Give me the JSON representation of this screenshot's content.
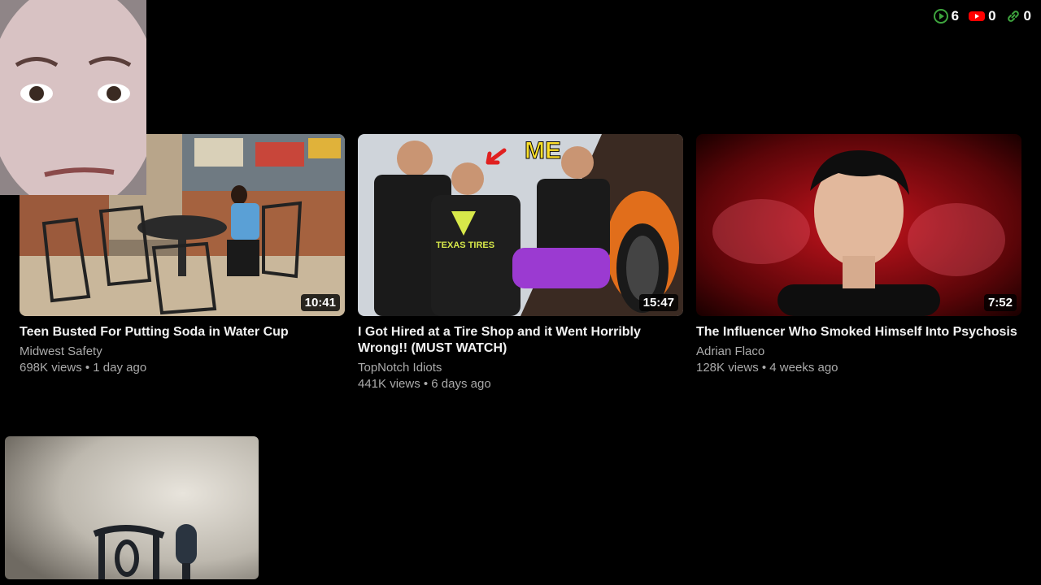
{
  "counters": [
    {
      "icon": "play-icon",
      "value": "6",
      "color": "#3ea53e"
    },
    {
      "icon": "youtube-icon",
      "value": "0",
      "color": "#ff0000"
    },
    {
      "icon": "link-icon",
      "value": "0",
      "color": "#3ea53e"
    }
  ],
  "videos": [
    {
      "title": "Teen Busted For Putting Soda in Water Cup",
      "channel": "Midwest Safety",
      "meta": "698K views • 1 day ago",
      "duration": "10:41"
    },
    {
      "title": "I Got Hired at a Tire Shop and it Went Horribly Wrong!! (MUST WATCH)",
      "channel": "TopNotch Idiots",
      "meta": "441K views • 6 days ago",
      "duration": "15:47",
      "overlay_text": "ME",
      "shirt_text": "TEXAS TIRES"
    },
    {
      "title": "The Influencer Who Smoked Himself Into Psychosis",
      "channel": "Adrian Flaco",
      "meta": "128K views • 4 weeks ago",
      "duration": "7:52"
    }
  ]
}
